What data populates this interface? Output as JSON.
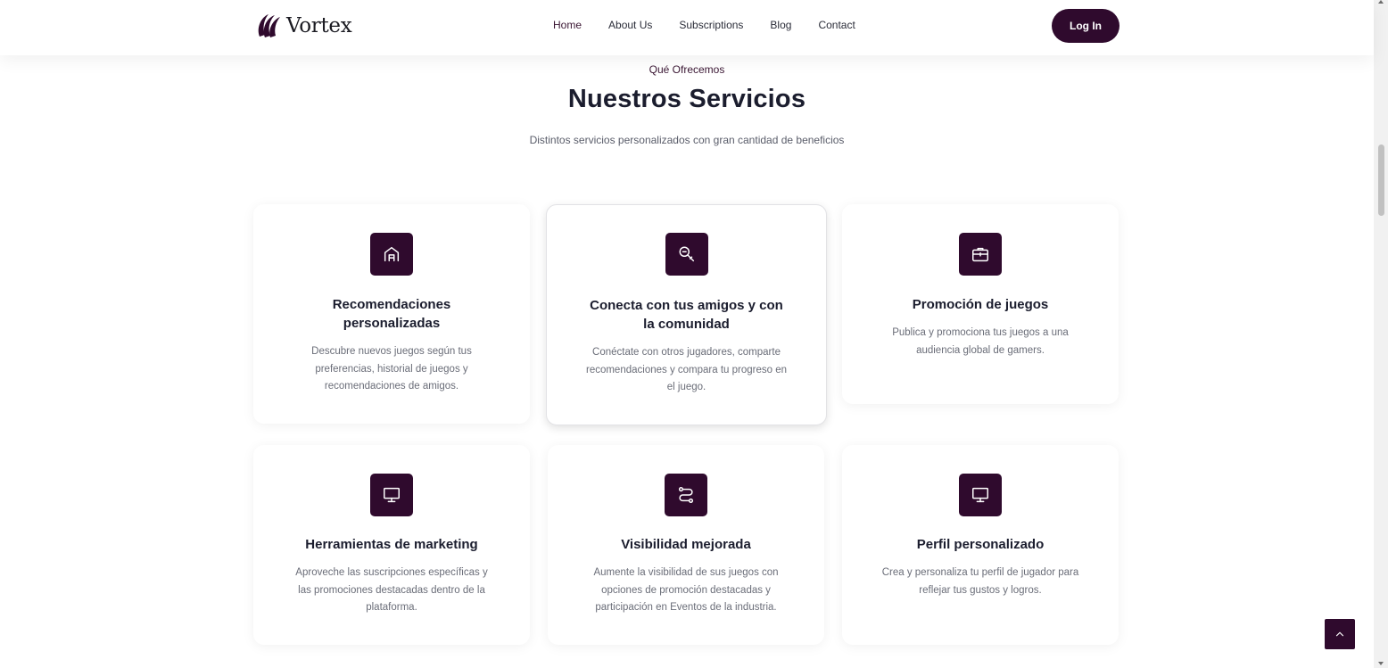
{
  "nav": {
    "logo_text": "Vortex",
    "links": [
      "Home",
      "About Us",
      "Subscriptions",
      "Blog",
      "Contact"
    ],
    "login_label": "Log In"
  },
  "section": {
    "eyebrow": "Qué Ofrecemos",
    "title": "Nuestros Servicios",
    "subtitle": "Distintos servicios personalizados con gran cantidad de beneficios"
  },
  "cards": [
    {
      "icon": "home-icon",
      "title": "Recomendaciones personalizadas",
      "desc": "Descubre nuevos juegos según tus preferencias, historial de juegos y recomendaciones de amigos."
    },
    {
      "icon": "search-icon",
      "title": "Conecta con tus amigos y con la comunidad",
      "desc": "Conéctate con otros jugadores, comparte recomendaciones y compara tu progreso en el juego."
    },
    {
      "icon": "briefcase-icon",
      "title": "Promoción de juegos",
      "desc": "Publica y promociona tus juegos a una audiencia global de gamers."
    },
    {
      "icon": "monitor-icon",
      "title": "Herramientas de marketing",
      "desc": "Aproveche las suscripciones específicas y las promociones destacadas dentro de la plataforma."
    },
    {
      "icon": "route-icon",
      "title": "Visibilidad mejorada",
      "desc": "Aumente la visibilidad de sus juegos con opciones de promoción destacadas y participación en Eventos de la industria."
    },
    {
      "icon": "monitor-icon",
      "title": "Perfil personalizado",
      "desc": "Crea y personaliza tu perfil de jugador para reflejar tus gustos y logros."
    }
  ],
  "colors": {
    "brand": "#2f0a2d",
    "heading": "#1b1d2e",
    "body_text": "#6a6d78"
  }
}
